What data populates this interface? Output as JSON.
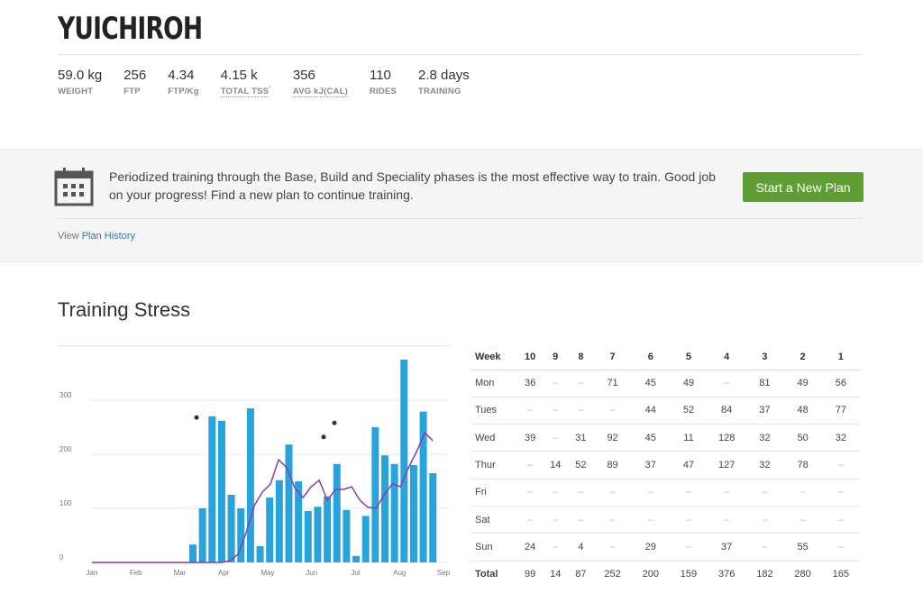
{
  "profile": {
    "name": "YUICHIROH"
  },
  "stats": [
    {
      "value": "59.0 kg",
      "label": "WEIGHT"
    },
    {
      "value": "256",
      "label": "FTP"
    },
    {
      "value": "4.34",
      "label": "FTP/Kg"
    },
    {
      "value": "4.15 k",
      "label": "TOTAL TSS"
    },
    {
      "value": "356",
      "label": "AVG kJ(CAL)"
    },
    {
      "value": "110",
      "label": "RIDES"
    },
    {
      "value": "2.8 days",
      "label": "TRAINING"
    }
  ],
  "banner": {
    "message": "Periodized training through the Base, Build and Speciality phases is the most effective way to train. Good job on your progress! Find a new plan to continue training.",
    "button_label": "Start a New Plan",
    "history_prefix": "View",
    "history_link": "Plan History",
    "icon": "calendar-icon"
  },
  "section": {
    "title": "Training Stress"
  },
  "colors": {
    "bar": "#29a3dc",
    "line": "#8a3ca8",
    "button": "#5e9e32",
    "link": "#2a7ab8"
  },
  "chart_data": {
    "type": "bar",
    "title": "",
    "xlabel": "",
    "ylabel": "",
    "ylim": [
      0,
      400
    ],
    "yticks": [
      "0",
      "100",
      "200",
      "300"
    ],
    "xticks": [
      "Jan",
      "Feb",
      "Mar",
      "Apr",
      "May",
      "Jun",
      "Jul",
      "Aug",
      "Sep"
    ],
    "grid": true,
    "series": [
      {
        "values": [
          33,
          100,
          270,
          262,
          125,
          100,
          285,
          30,
          120,
          152,
          218,
          150,
          95,
          103,
          122,
          182,
          97,
          12,
          86,
          250,
          198,
          182,
          375,
          180,
          279,
          165
        ]
      },
      {
        "values": [
          0,
          0,
          0,
          0,
          0,
          0,
          0,
          0,
          0,
          0,
          0,
          0,
          0,
          0,
          0,
          0,
          0,
          3,
          15,
          55,
          105,
          130,
          145,
          190,
          175,
          138,
          120,
          140,
          152,
          115,
          135,
          135,
          140,
          115,
          102,
          100,
          125,
          145,
          140,
          175,
          205,
          240,
          225
        ]
      }
    ],
    "points": [
      268,
      232,
      258
    ]
  },
  "weeks_table": {
    "headers": [
      "Week",
      "10",
      "9",
      "8",
      "7",
      "6",
      "5",
      "4",
      "3",
      "2",
      "1"
    ],
    "rows": [
      [
        "Mon",
        "36",
        "–",
        "–",
        "71",
        "45",
        "49",
        "–",
        "81",
        "49",
        "56"
      ],
      [
        "Tues",
        "–",
        "–",
        "–",
        "–",
        "44",
        "52",
        "84",
        "37",
        "48",
        "77"
      ],
      [
        "Wed",
        "39",
        "–",
        "31",
        "92",
        "45",
        "11",
        "128",
        "32",
        "50",
        "32"
      ],
      [
        "Thur",
        "–",
        "14",
        "52",
        "89",
        "37",
        "47",
        "127",
        "32",
        "78",
        "–"
      ],
      [
        "Fri",
        "–",
        "–",
        "–",
        "–",
        "–",
        "–",
        "–",
        "–",
        "–",
        "–"
      ],
      [
        "Sat",
        "–",
        "–",
        "–",
        "–",
        "–",
        "–",
        "–",
        "–",
        "–",
        "–"
      ],
      [
        "Sun",
        "24",
        "–",
        "4",
        "–",
        "29",
        "–",
        "37",
        "–",
        "55",
        "–"
      ]
    ],
    "total": [
      "Total",
      "99",
      "14",
      "87",
      "252",
      "200",
      "159",
      "376",
      "182",
      "280",
      "165"
    ]
  }
}
